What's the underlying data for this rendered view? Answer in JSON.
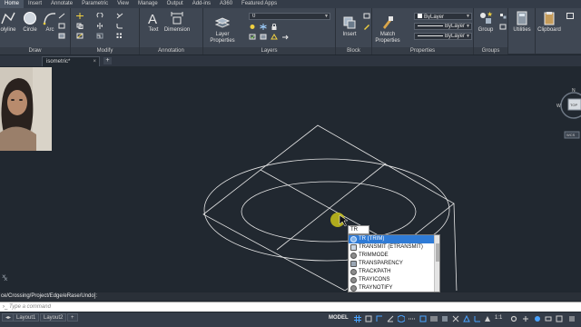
{
  "ribbon_tabs": [
    "Home",
    "Insert",
    "Annotate",
    "Parametric",
    "View",
    "Manage",
    "Output",
    "Add-ins",
    "A360",
    "Featured Apps"
  ],
  "active_tab": "Home",
  "panels": {
    "draw": {
      "title": "Draw",
      "polyline": "olyline",
      "circle": "Circle",
      "arc": "Arc"
    },
    "modify": {
      "title": "Modify"
    },
    "annotation": {
      "title": "Annotation",
      "text": "Text",
      "dimension": "Dimension"
    },
    "layers": {
      "title": "Layers",
      "layer_properties": "Layer\nProperties",
      "layer_value": "0"
    },
    "block": {
      "title": "Block",
      "insert": "Insert"
    },
    "properties": {
      "title": "Properties",
      "match_properties": "Match\nProperties",
      "color": "ByLayer",
      "linetype": "ByLayer",
      "lineweight": "ByLayer"
    },
    "groups": {
      "title": "Groups",
      "group": "Group"
    },
    "utilities": {
      "label": "Utilities"
    },
    "clipboard": {
      "label": "Clipboard"
    }
  },
  "file_tab": {
    "name": "isometric*",
    "close": "×"
  },
  "new_tab": "+",
  "viewcube": {
    "top": "TOP",
    "n": "N",
    "w": "W",
    "wcs": "WCS"
  },
  "command": {
    "typed": "TR",
    "history": "ce/Crossing/Project/Edge/eRase/Undo]:",
    "placeholder": "Type a command",
    "close_x": "×"
  },
  "autocomplete": [
    "TR (TRIM)",
    "TRANSMIT (ETRANSMIT)",
    "TRIMMODE",
    "TRANSPARENCY",
    "TRACKPATH",
    "TRAYICONS",
    "TRAYNOTIFY"
  ],
  "status": {
    "layout1": "Layout1",
    "layout2": "Layout2",
    "model": "MODEL",
    "scale": "1:1"
  },
  "colors": {
    "background": "#212830",
    "ribbon": "#3f4753",
    "selection": "#2f7bd6",
    "cursor_highlight": "#d8d024"
  }
}
